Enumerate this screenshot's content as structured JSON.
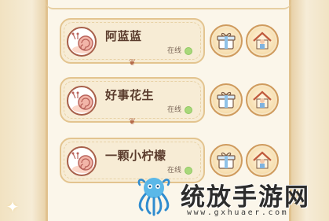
{
  "friends": [
    {
      "name": "阿蓝蓝",
      "status": "在线"
    },
    {
      "name": "好事花生",
      "status": "在线"
    },
    {
      "name": "一颗小柠檬",
      "status": "在线"
    }
  ],
  "colors": {
    "online_dot": "#a9d87a",
    "card_border": "#e3c48f",
    "name_text": "#5a3b2c"
  },
  "icons": {
    "gift": "gift-icon",
    "visit": "visit-house-icon",
    "avatar": "snail-avatar-icon"
  },
  "watermark": {
    "text": "统放手游网",
    "url": "www.gxhuaer.com"
  }
}
